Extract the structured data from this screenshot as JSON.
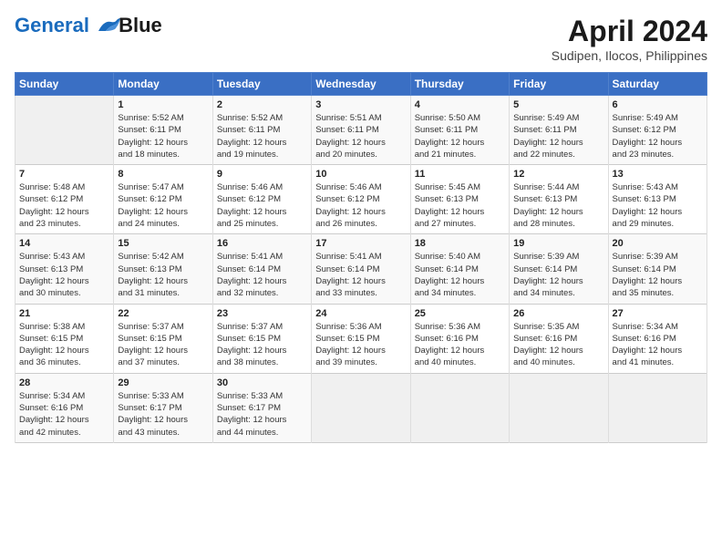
{
  "header": {
    "logo_line1": "General",
    "logo_line2": "Blue",
    "month_title": "April 2024",
    "subtitle": "Sudipen, Ilocos, Philippines"
  },
  "calendar": {
    "days_of_week": [
      "Sunday",
      "Monday",
      "Tuesday",
      "Wednesday",
      "Thursday",
      "Friday",
      "Saturday"
    ],
    "weeks": [
      [
        {
          "day": "",
          "info": ""
        },
        {
          "day": "1",
          "info": "Sunrise: 5:52 AM\nSunset: 6:11 PM\nDaylight: 12 hours\nand 18 minutes."
        },
        {
          "day": "2",
          "info": "Sunrise: 5:52 AM\nSunset: 6:11 PM\nDaylight: 12 hours\nand 19 minutes."
        },
        {
          "day": "3",
          "info": "Sunrise: 5:51 AM\nSunset: 6:11 PM\nDaylight: 12 hours\nand 20 minutes."
        },
        {
          "day": "4",
          "info": "Sunrise: 5:50 AM\nSunset: 6:11 PM\nDaylight: 12 hours\nand 21 minutes."
        },
        {
          "day": "5",
          "info": "Sunrise: 5:49 AM\nSunset: 6:11 PM\nDaylight: 12 hours\nand 22 minutes."
        },
        {
          "day": "6",
          "info": "Sunrise: 5:49 AM\nSunset: 6:12 PM\nDaylight: 12 hours\nand 23 minutes."
        }
      ],
      [
        {
          "day": "7",
          "info": "Sunrise: 5:48 AM\nSunset: 6:12 PM\nDaylight: 12 hours\nand 23 minutes."
        },
        {
          "day": "8",
          "info": "Sunrise: 5:47 AM\nSunset: 6:12 PM\nDaylight: 12 hours\nand 24 minutes."
        },
        {
          "day": "9",
          "info": "Sunrise: 5:46 AM\nSunset: 6:12 PM\nDaylight: 12 hours\nand 25 minutes."
        },
        {
          "day": "10",
          "info": "Sunrise: 5:46 AM\nSunset: 6:12 PM\nDaylight: 12 hours\nand 26 minutes."
        },
        {
          "day": "11",
          "info": "Sunrise: 5:45 AM\nSunset: 6:13 PM\nDaylight: 12 hours\nand 27 minutes."
        },
        {
          "day": "12",
          "info": "Sunrise: 5:44 AM\nSunset: 6:13 PM\nDaylight: 12 hours\nand 28 minutes."
        },
        {
          "day": "13",
          "info": "Sunrise: 5:43 AM\nSunset: 6:13 PM\nDaylight: 12 hours\nand 29 minutes."
        }
      ],
      [
        {
          "day": "14",
          "info": "Sunrise: 5:43 AM\nSunset: 6:13 PM\nDaylight: 12 hours\nand 30 minutes."
        },
        {
          "day": "15",
          "info": "Sunrise: 5:42 AM\nSunset: 6:13 PM\nDaylight: 12 hours\nand 31 minutes."
        },
        {
          "day": "16",
          "info": "Sunrise: 5:41 AM\nSunset: 6:14 PM\nDaylight: 12 hours\nand 32 minutes."
        },
        {
          "day": "17",
          "info": "Sunrise: 5:41 AM\nSunset: 6:14 PM\nDaylight: 12 hours\nand 33 minutes."
        },
        {
          "day": "18",
          "info": "Sunrise: 5:40 AM\nSunset: 6:14 PM\nDaylight: 12 hours\nand 34 minutes."
        },
        {
          "day": "19",
          "info": "Sunrise: 5:39 AM\nSunset: 6:14 PM\nDaylight: 12 hours\nand 34 minutes."
        },
        {
          "day": "20",
          "info": "Sunrise: 5:39 AM\nSunset: 6:14 PM\nDaylight: 12 hours\nand 35 minutes."
        }
      ],
      [
        {
          "day": "21",
          "info": "Sunrise: 5:38 AM\nSunset: 6:15 PM\nDaylight: 12 hours\nand 36 minutes."
        },
        {
          "day": "22",
          "info": "Sunrise: 5:37 AM\nSunset: 6:15 PM\nDaylight: 12 hours\nand 37 minutes."
        },
        {
          "day": "23",
          "info": "Sunrise: 5:37 AM\nSunset: 6:15 PM\nDaylight: 12 hours\nand 38 minutes."
        },
        {
          "day": "24",
          "info": "Sunrise: 5:36 AM\nSunset: 6:15 PM\nDaylight: 12 hours\nand 39 minutes."
        },
        {
          "day": "25",
          "info": "Sunrise: 5:36 AM\nSunset: 6:16 PM\nDaylight: 12 hours\nand 40 minutes."
        },
        {
          "day": "26",
          "info": "Sunrise: 5:35 AM\nSunset: 6:16 PM\nDaylight: 12 hours\nand 40 minutes."
        },
        {
          "day": "27",
          "info": "Sunrise: 5:34 AM\nSunset: 6:16 PM\nDaylight: 12 hours\nand 41 minutes."
        }
      ],
      [
        {
          "day": "28",
          "info": "Sunrise: 5:34 AM\nSunset: 6:16 PM\nDaylight: 12 hours\nand 42 minutes."
        },
        {
          "day": "29",
          "info": "Sunrise: 5:33 AM\nSunset: 6:17 PM\nDaylight: 12 hours\nand 43 minutes."
        },
        {
          "day": "30",
          "info": "Sunrise: 5:33 AM\nSunset: 6:17 PM\nDaylight: 12 hours\nand 44 minutes."
        },
        {
          "day": "",
          "info": ""
        },
        {
          "day": "",
          "info": ""
        },
        {
          "day": "",
          "info": ""
        },
        {
          "day": "",
          "info": ""
        }
      ]
    ]
  }
}
